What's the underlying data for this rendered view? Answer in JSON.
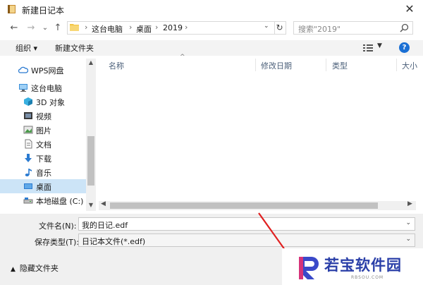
{
  "window": {
    "title": "新建日记本",
    "close_glyph": "✕"
  },
  "nav": {
    "back": "←",
    "forward": "→",
    "recent": "⌄",
    "up": "↑",
    "breadcrumb": [
      "这台电脑",
      "桌面",
      "2019"
    ],
    "breadcrumb_sep": "›",
    "refresh": "↻",
    "search_placeholder": "搜索\"2019\""
  },
  "toolbar": {
    "organize": "组织 ▾",
    "new_folder": "新建文件夹",
    "view_dd": "▼",
    "help": "?"
  },
  "sidebar": {
    "items": [
      {
        "label": "WPS网盘",
        "icon": "cloud-icon"
      },
      {
        "label": "这台电脑",
        "icon": "computer-icon"
      },
      {
        "label": "3D 对象",
        "icon": "cube-icon"
      },
      {
        "label": "视频",
        "icon": "video-icon"
      },
      {
        "label": "图片",
        "icon": "picture-icon"
      },
      {
        "label": "文档",
        "icon": "document-icon"
      },
      {
        "label": "下载",
        "icon": "download-icon"
      },
      {
        "label": "音乐",
        "icon": "music-icon"
      },
      {
        "label": "桌面",
        "icon": "desktop-icon",
        "selected": true
      },
      {
        "label": "本地磁盘 (C:)",
        "icon": "drive-icon"
      }
    ]
  },
  "columns": [
    "名称",
    "修改日期",
    "类型",
    "大小"
  ],
  "form": {
    "filename_label": "文件名(N):",
    "filename_value": "我的日记.edf",
    "filetype_label": "保存类型(T):",
    "filetype_value": "日记本文件(*.edf)",
    "dd": "⌄"
  },
  "hide_folders": "隐藏文件夹",
  "watermark": {
    "text": "若宝软件园",
    "sub": "RBSOU.COM"
  },
  "colors": {
    "selected": "#cce4f7",
    "accent": "#1a6fd4",
    "annotation_arrow": "#e02020"
  }
}
